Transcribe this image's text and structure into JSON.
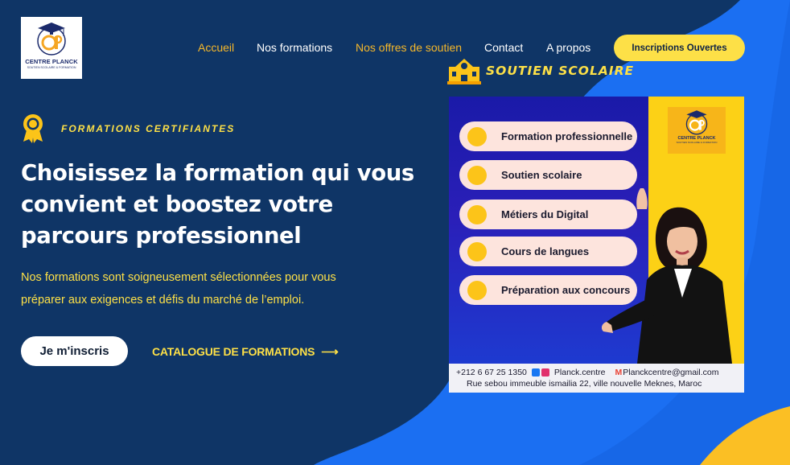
{
  "logo": {
    "title": "CENTRE PLANCK",
    "subtitle": "SOUTIEN SCOLAIRE & FORMATION",
    "monogram": "CP"
  },
  "nav": {
    "items": [
      {
        "label": "Accueil",
        "active": true
      },
      {
        "label": "Nos formations",
        "active": false
      },
      {
        "label": "Nos offres de soutien",
        "active": false
      },
      {
        "label": "Contact",
        "active": false
      },
      {
        "label": "A propos",
        "active": false
      }
    ],
    "cta_label": "Inscriptions Ouvertes"
  },
  "soutien_heading": "SOUTIEN SCOLAIRE",
  "hero": {
    "eyebrow": "FORMATIONS CERTIFIANTES",
    "headline": "Choisissez la formation qui vous convient et boostez votre parcours professionnel",
    "paragraph": "Nos formations sont soigneusement sélectionnées pour vous préparer aux exigences et défis du marché de l’emploi.",
    "primary_button": "Je m'inscris",
    "secondary_link": "CATALOGUE DE FORMATIONS",
    "arrow": "⟶"
  },
  "promo": {
    "logo_title": "CENTRE PLANCK",
    "logo_subtitle": "SOUTIEN SCOLAIRE & FORMATION",
    "items": [
      "Formation professionnelle",
      "Soutien scolaire",
      "Métiers du Digital",
      "Cours de langues",
      "Préparation aux concours"
    ],
    "phone": "+212 6 67 25 1350",
    "social": "Planck.centre",
    "email": "Planckcentre@gmail.com",
    "address": "Rue sebou immeuble ismailia 22, ville nouvelle Meknes, Maroc"
  },
  "colors": {
    "background": "#0f3566",
    "accent_blue": "#1e6ff0",
    "accent_yellow": "#fde047",
    "accent_orange": "#f5b72a"
  }
}
